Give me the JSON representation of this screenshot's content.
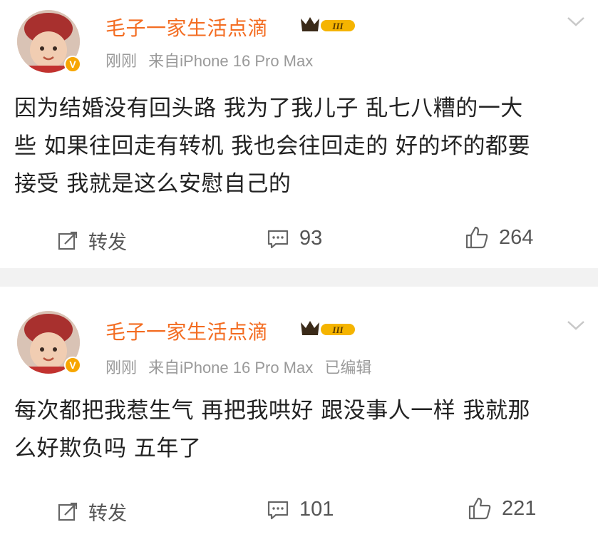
{
  "posts": [
    {
      "username": "毛子一家生活点滴",
      "time": "刚刚",
      "source": "来自iPhone 16 Pro Max",
      "edited": "",
      "content_lines": [
        "因为结婚没有回头路 我为了我儿子 乱七八糟的一大",
        "些 如果往回走有转机 我也会往回走的 好的坏的都要",
        "接受 我就是这么安慰自己的"
      ],
      "repost_label": "转发",
      "comment_count": "93",
      "like_count": "264",
      "icons": {
        "repost": "repost-icon",
        "comment": "comment-icon",
        "like": "like-icon",
        "more": "chevron-down-icon",
        "vip": "crown-badge-icon",
        "verified": "verified-v-icon"
      }
    },
    {
      "username": "毛子一家生活点滴",
      "time": "刚刚",
      "source": "来自iPhone 16 Pro Max",
      "edited": "已编辑",
      "content_lines": [
        "每次都把我惹生气 再把我哄好 跟没事人一样 我就那",
        "么好欺负吗 五年了"
      ],
      "repost_label": "转发",
      "comment_count": "101",
      "like_count": "221",
      "icons": {
        "repost": "repost-icon",
        "comment": "comment-icon",
        "like": "like-icon",
        "more": "chevron-down-icon",
        "vip": "crown-badge-icon",
        "verified": "verified-v-icon"
      }
    }
  ],
  "badge_text": "III",
  "verified_glyph": "V",
  "colors": {
    "username": "#f36c21",
    "meta": "#9a9a9a",
    "text": "#222222",
    "badge": "#f7a600",
    "divider": "#f2f2f2"
  }
}
